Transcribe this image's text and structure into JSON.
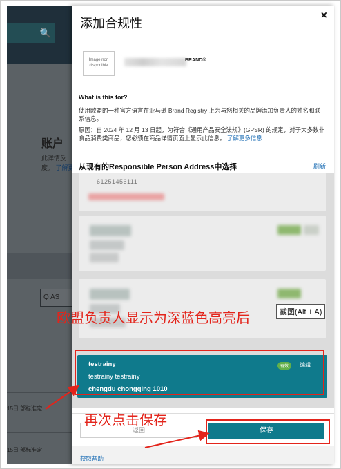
{
  "background": {
    "account_title": "账户",
    "sub_line1": "此详情反",
    "sub_line2_prefix": "度。",
    "sub_line2_link": "了解更",
    "search_placeholder": "Q AS",
    "row1_text": "15日 部标准定",
    "row2_text": "15日 部标准定"
  },
  "modal": {
    "title": "添加合规性",
    "close_glyph": "×",
    "brand_image_alt": "Image non disponible",
    "brand_suffix": "BRAND®",
    "what_heading": "What is this for?",
    "para1": "使用欧盟的一种官方语言在亚马逊 Brand Registry 上为与您相关的品牌添加负责人的姓名和联系信息。",
    "para2": "原因：自 2024 年 12 月 13 日起，为符合《通用产品安全法规》(GPSR) 的规定，对于大多数非食品消费类商品，您必须在商品详情页面上显示此信息。",
    "para2_link": "了解更多信息",
    "select_heading": "从现有的Responsible Person Address中选择",
    "refresh_label": "刷新",
    "first_card_phone": "61251456111",
    "selected_address": {
      "name": "testrainy",
      "line1": "testrainy testrainy",
      "line2": "chengdu chongqing 1010",
      "badge": "有效",
      "edit_label": "编辑"
    },
    "back_label": "返回",
    "save_label": "保存",
    "help_label": "获取帮助"
  },
  "annotations": {
    "highlight_note": "欧盟负责人显示为深蓝色高亮后",
    "save_note": "再次点击保存",
    "tooltip": "截图(Alt + A)"
  },
  "colors": {
    "accent_teal": "#0f7a8c",
    "annotation_red": "#e3241b",
    "link_blue": "#1f6fb5"
  }
}
